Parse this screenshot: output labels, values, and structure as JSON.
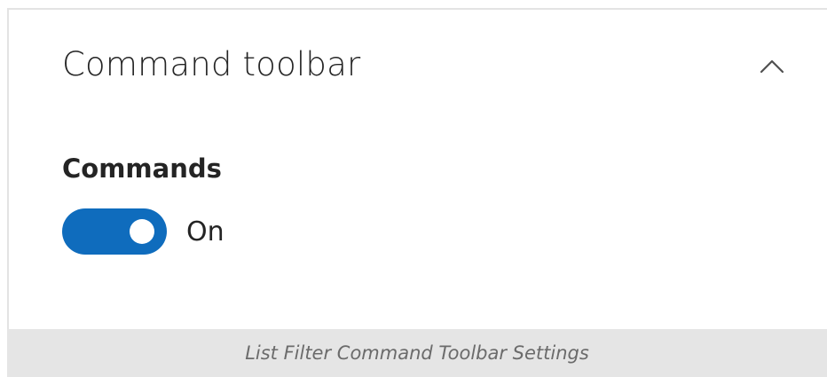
{
  "section": {
    "title": "Command toolbar",
    "collapse_icon": "chevron-up-icon"
  },
  "commands": {
    "label": "Commands",
    "toggle_state": true,
    "toggle_text": "On"
  },
  "caption": "List Filter Command Toolbar Settings",
  "colors": {
    "toggle_on": "#0f6cbd",
    "caption_background": "#e5e5e5",
    "caption_text": "#6b6b6b"
  }
}
